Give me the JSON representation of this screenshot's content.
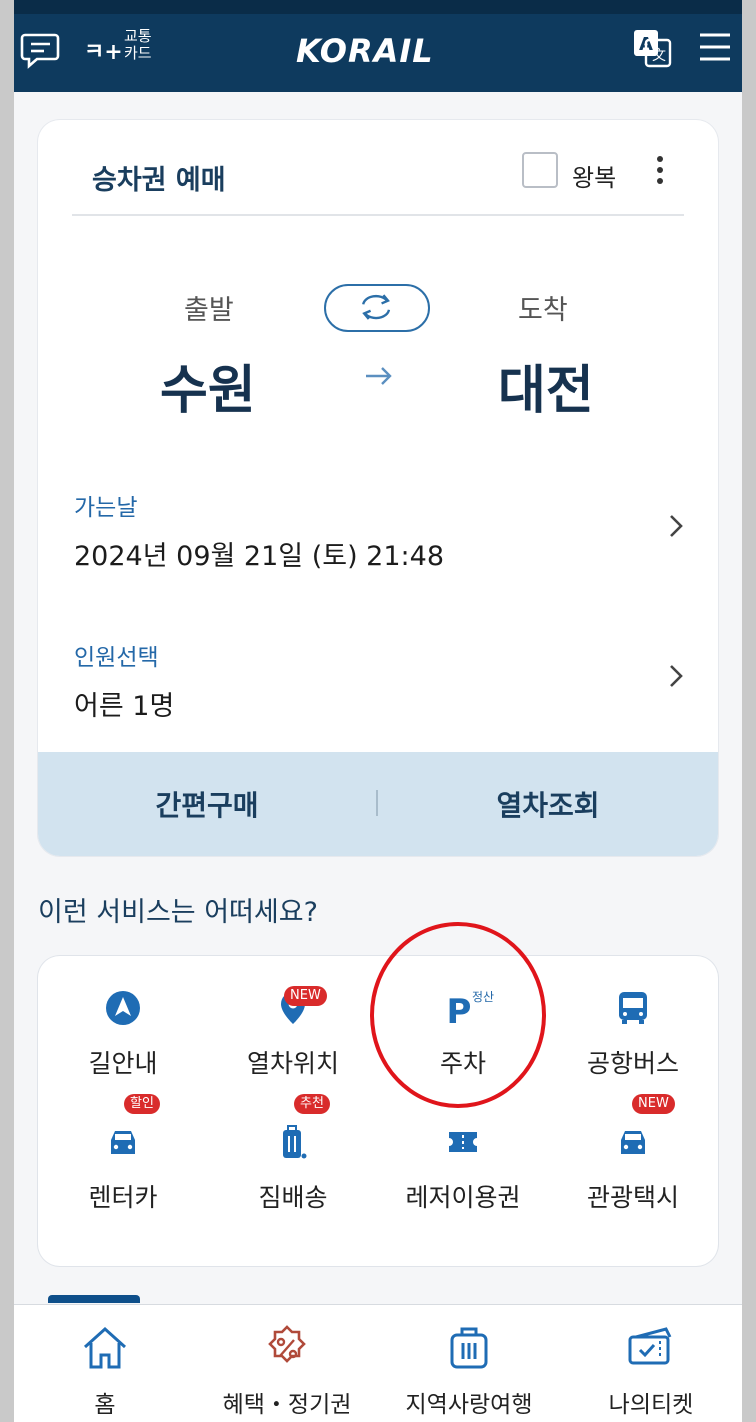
{
  "header": {
    "transport_card_label_1": "교통",
    "transport_card_label_2": "카드",
    "logo_text": "KORAIL"
  },
  "booking": {
    "title": "승차권 예매",
    "roundtrip_label": "왕복",
    "departure_label": "출발",
    "arrival_label": "도착",
    "departure_station": "수원",
    "arrival_station": "대전",
    "date_label": "가는날",
    "date_value": "2024년 09월 21일 (토) 21:48",
    "passenger_label": "인원선택",
    "passenger_value": "어른 1명",
    "quick_buy_label": "간편구매",
    "search_train_label": "열차조회"
  },
  "services": {
    "title": "이런 서비스는 어떠세요?",
    "items": [
      {
        "label": "길안내",
        "icon": "navigation-icon"
      },
      {
        "label": "열차위치",
        "icon": "location-pin-icon",
        "badge": "NEW"
      },
      {
        "label": "주차",
        "icon": "parking-icon",
        "sup": "정산"
      },
      {
        "label": "공항버스",
        "icon": "bus-icon"
      },
      {
        "label": "렌터카",
        "icon": "car-icon",
        "badge": "할인"
      },
      {
        "label": "짐배송",
        "icon": "luggage-icon",
        "badge": "추천"
      },
      {
        "label": "레저이용권",
        "icon": "ticket-icon"
      },
      {
        "label": "관광택시",
        "icon": "taxi-icon",
        "badge": "NEW"
      }
    ]
  },
  "bottom_nav": {
    "items": [
      {
        "label": "홈",
        "icon": "home-icon"
      },
      {
        "label": "혜택・정기권",
        "icon": "discount-icon"
      },
      {
        "label": "지역사랑여행",
        "icon": "suitcase-icon"
      },
      {
        "label": "나의티켓",
        "icon": "my-ticket-icon"
      }
    ]
  },
  "colors": {
    "header_bg": "#0e3a5e",
    "accent_blue": "#2468a8",
    "action_bar_bg": "#d2e3ef",
    "badge_red": "#d92b2b",
    "highlight_red": "#e0151b"
  }
}
